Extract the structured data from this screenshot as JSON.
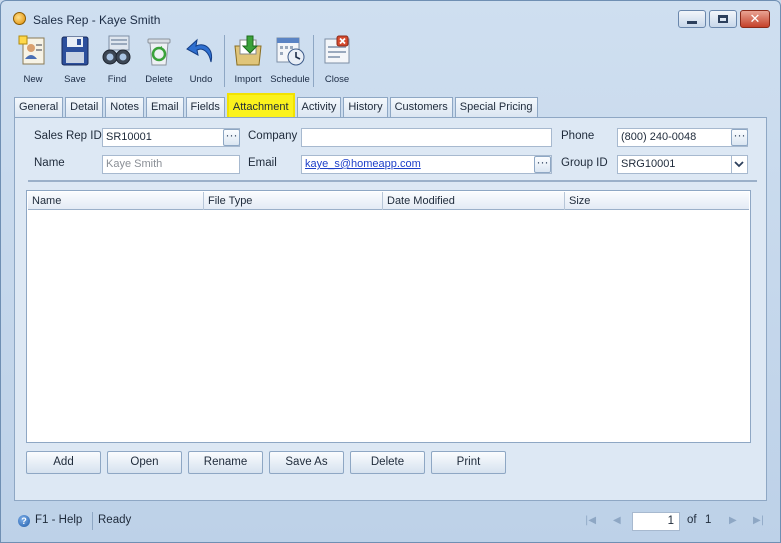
{
  "window": {
    "title": "Sales Rep - Kaye Smith"
  },
  "toolbar": {
    "new": "New",
    "save": "Save",
    "find": "Find",
    "delete": "Delete",
    "undo": "Undo",
    "import": "Import",
    "schedule": "Schedule",
    "close": "Close"
  },
  "tabs": [
    "General",
    "Detail",
    "Notes",
    "Email",
    "Fields",
    "Attachment",
    "Activity",
    "History",
    "Customers",
    "Special Pricing"
  ],
  "active_tab": "Attachment",
  "form": {
    "sales_rep_id_label": "Sales Rep ID",
    "sales_rep_id": "SR10001",
    "company_label": "Company",
    "company": "",
    "phone_label": "Phone",
    "phone": "(800) 240-0048",
    "name_label": "Name",
    "name": "Kaye Smith",
    "email_label": "Email",
    "email": "kaye_s@homeapp.com",
    "group_id_label": "Group ID",
    "group_id": "SRG10001"
  },
  "grid": {
    "columns": [
      "Name",
      "File Type",
      "Date Modified",
      "Size"
    ],
    "rows": []
  },
  "buttons": {
    "add": "Add",
    "open": "Open",
    "rename": "Rename",
    "save_as": "Save As",
    "delete": "Delete",
    "print": "Print"
  },
  "status": {
    "help": "F1 - Help",
    "state": "Ready",
    "page": "1",
    "of": "of",
    "total": "1"
  },
  "colors": {
    "active_tab": "#fbf21d",
    "link": "#1d3fc9"
  }
}
